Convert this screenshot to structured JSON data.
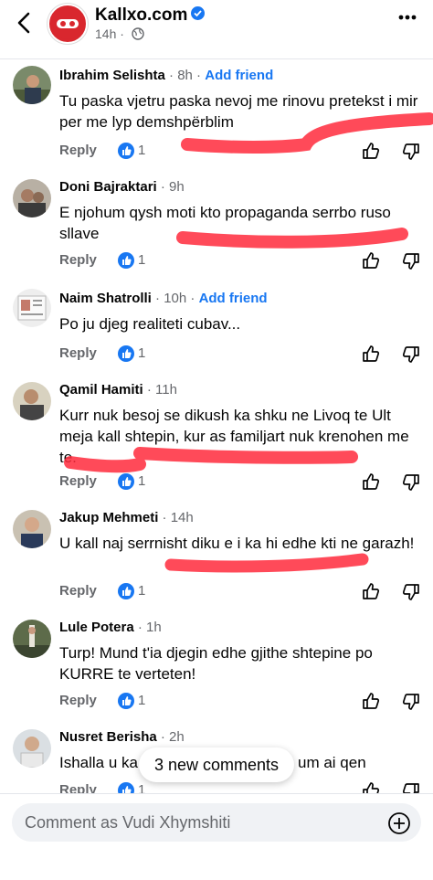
{
  "header": {
    "page_name": "Kallxo.com",
    "time": "14h",
    "logo_color": "#d9272e"
  },
  "comments": [
    {
      "name": "Ibrahim Selishta",
      "time": "· 8h ·",
      "add_friend": "Add friend",
      "text": "Tu paska vjetru paska nevoj me rinovu pretekst i mir per me lyp demshpërblim",
      "reply": "Reply",
      "likes": "1"
    },
    {
      "name": "Doni Bajraktari",
      "time": "· 9h",
      "add_friend": "",
      "text": "E njohum qysh moti kto propaganda serrbo ruso sllave",
      "reply": "Reply",
      "likes": "1"
    },
    {
      "name": "Naim Shatrolli",
      "time": "· 10h ·",
      "add_friend": "Add friend",
      "text": "Po ju djeg realiteti cubav...",
      "reply": "Reply",
      "likes": "1"
    },
    {
      "name": "Qamil Hamiti",
      "time": "· 11h",
      "add_friend": "",
      "text": "Kurr nuk besoj se dikush ka shku ne Livoq te Ult meja kall shtepin, kur as familjart nuk krenohen me te.",
      "reply": "Reply",
      "likes": "1"
    },
    {
      "name": "Jakup Mehmeti",
      "time": "· 14h",
      "add_friend": "",
      "text": "U kall naj serrnisht diku e i ka hi edhe kti ne garazh!",
      "reply": "Reply",
      "likes": "1"
    },
    {
      "name": "Lule Potera",
      "time": "· 1h",
      "add_friend": "",
      "text": "Turp! Mund t'ia djegin edhe gjithe shtepine po KURRE te verteten!",
      "reply": "Reply",
      "likes": "1"
    },
    {
      "name": "Nusret Berisha",
      "time": "· 2h",
      "add_friend": "",
      "text": "Ishalla u ka",
      "text_tail": "um ai qen",
      "reply": "Reply",
      "likes": "1"
    }
  ],
  "new_comments_toast": "3 new comments",
  "composer": {
    "placeholder": "Comment as Vudi Xhymshiti"
  },
  "colors": {
    "accent": "#1877f2",
    "scribble": "#ff2a3c"
  }
}
